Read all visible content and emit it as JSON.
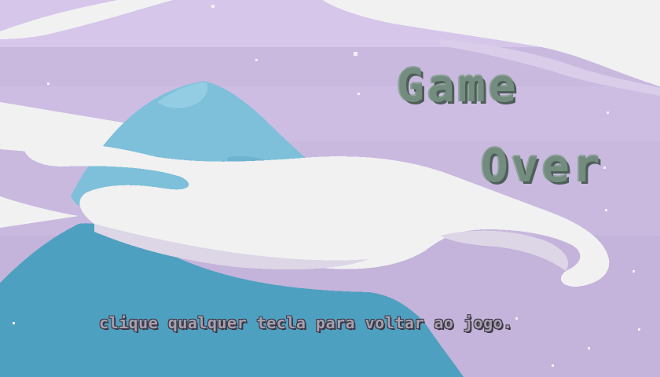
{
  "screen": {
    "title_line1": "Game",
    "title_line2": "Over",
    "prompt": "clique qualquer tecla para voltar ao jogo."
  },
  "colors": {
    "sky": "#cbbbe1",
    "sky_top": "#d9c9ea",
    "mountain_light": "#7ec0da",
    "mountain_dark": "#4ea0c0",
    "cloud": "#f1f1f1",
    "title_text": "#748b7f",
    "prompt_text": "#a6a0ae"
  }
}
